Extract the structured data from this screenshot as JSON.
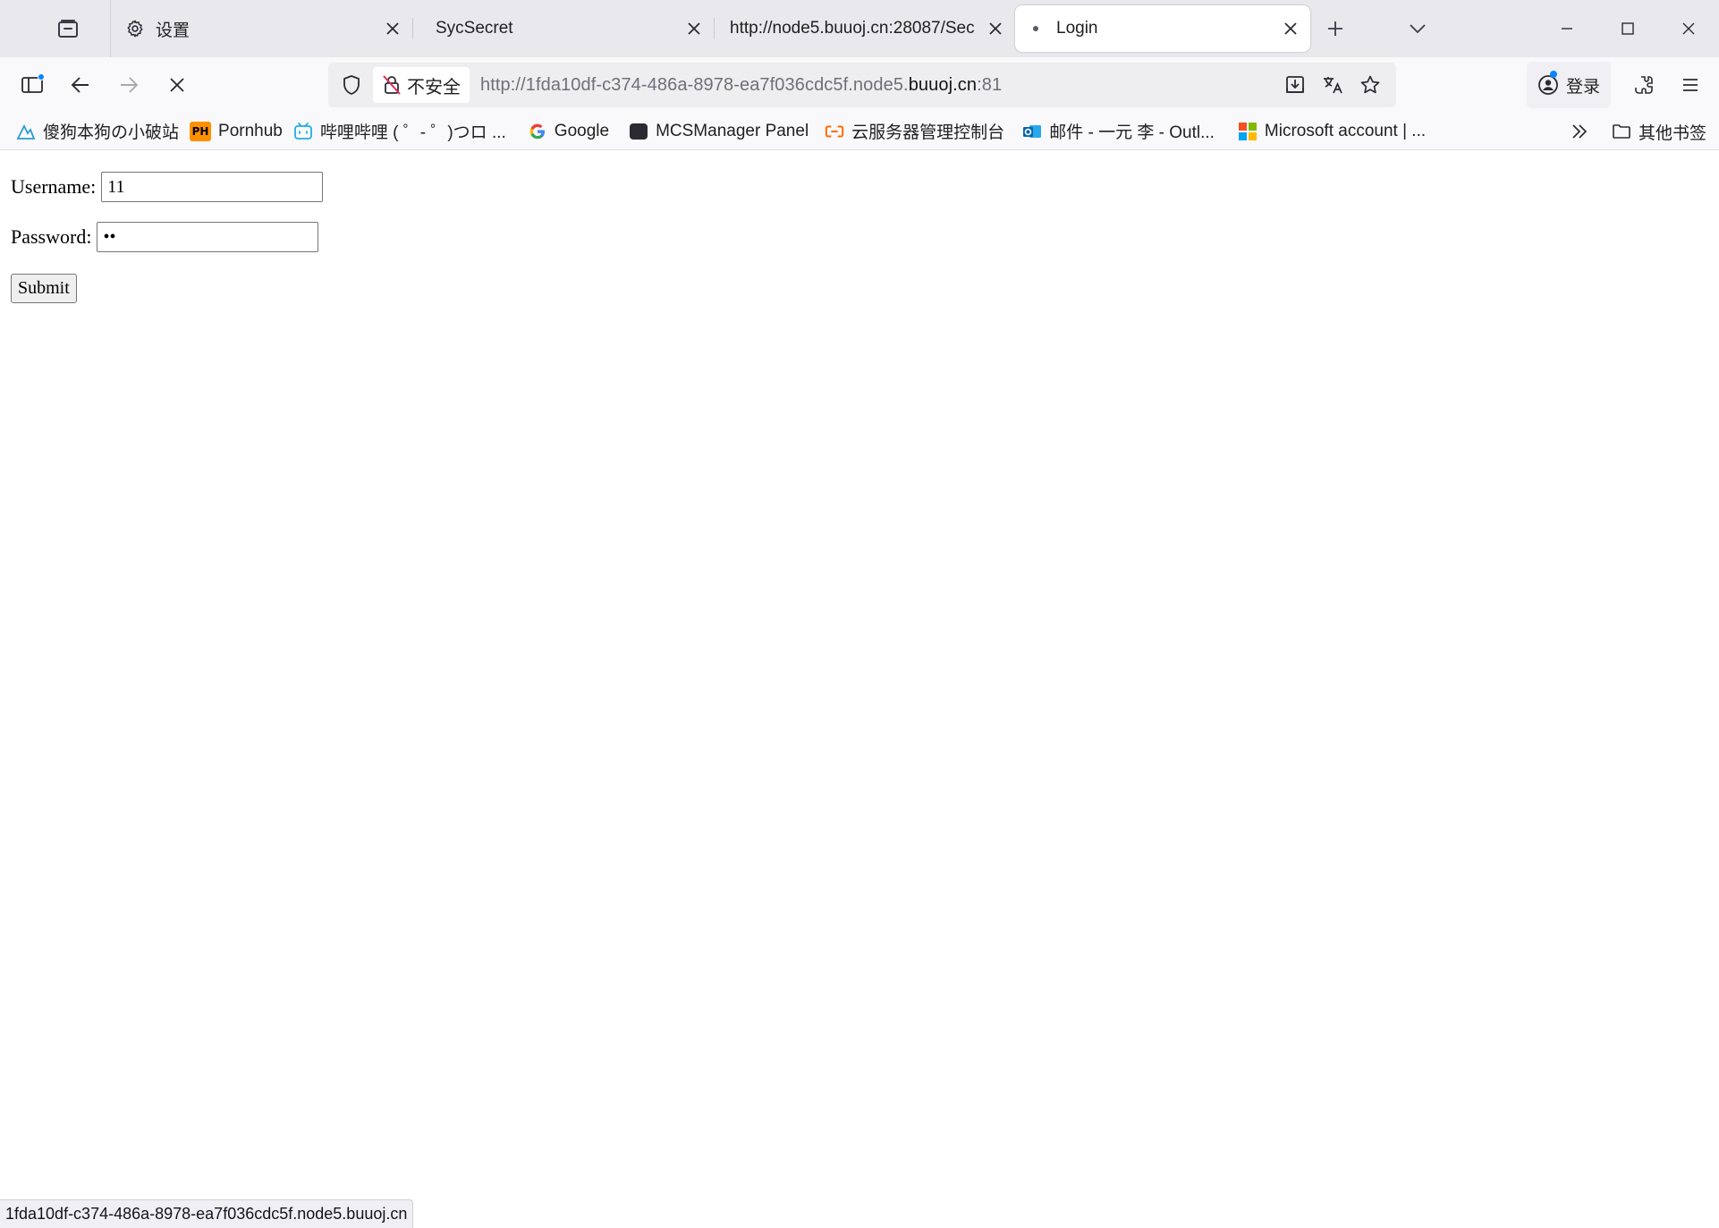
{
  "tabs": [
    {
      "label": "设置",
      "icon": "gear-icon",
      "active": false
    },
    {
      "label": "SycSecret",
      "icon": "",
      "active": false
    },
    {
      "label": "http://node5.buuoj.cn:28087/Sec",
      "icon": "",
      "active": false
    },
    {
      "label": "Login",
      "icon": "loading-dot-icon",
      "active": true
    }
  ],
  "navbar": {
    "security_label": "不安全",
    "url_prefix": "http://1fda10df-c374-486a-8978-ea7f036cdc5f.node5.",
    "url_domain": "buuoj.cn",
    "url_suffix": ":81",
    "account_label": "登录"
  },
  "bookmarks": [
    {
      "label": "傻狗本狗の小破站",
      "icon": "mountain-logo-icon"
    },
    {
      "label": "Pornhub",
      "icon": "ph-logo-icon"
    },
    {
      "label": "哔哩哔哩 ( ゜- ゜)つロ ...",
      "icon": "bilibili-tv-icon"
    },
    {
      "label": "Google",
      "icon": "google-g-icon"
    },
    {
      "label": "MCSManager Panel",
      "icon": "mcsm-logo-icon"
    },
    {
      "label": "云服务器管理控制台",
      "icon": "aliyun-logo-icon"
    },
    {
      "label": "邮件 - 一元 李 - Outl...",
      "icon": "outlook-icon"
    },
    {
      "label": "Microsoft account | ...",
      "icon": "microsoft-logo-icon"
    }
  ],
  "other_bookmarks_label": "其他书签",
  "form": {
    "username_label": "Username:",
    "username_value": "11",
    "password_label": "Password:",
    "password_value": "11",
    "submit_label": "Submit"
  },
  "status_text": "1fda10df-c374-486a-8978-ea7f036cdc5f.node5.buuoj.cn",
  "colors": {
    "tabbar_bg": "#e8e8ed",
    "toolbar_bg": "#f9f9fb",
    "urlbar_bg": "#eeeef1",
    "accent_dot": "#0a84ff",
    "insecure_icon": "#e22850"
  }
}
